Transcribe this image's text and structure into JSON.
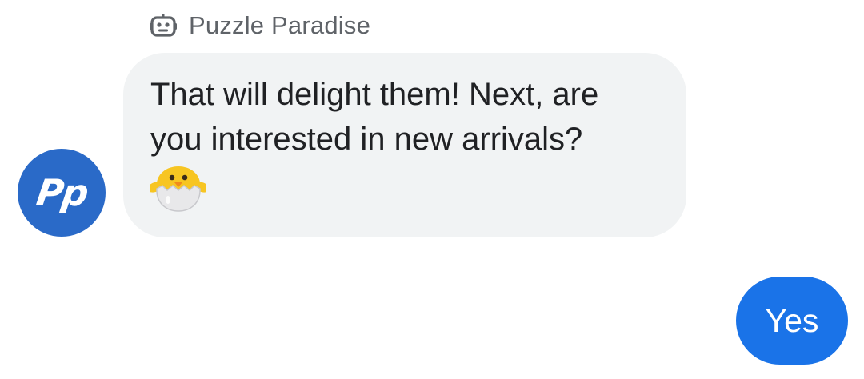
{
  "conversation": {
    "sender": {
      "name": "Puzzle Paradise",
      "icon": "bot-icon",
      "avatar_initials": "Pp",
      "avatar_color": "#2a6ac8"
    },
    "incoming_message": {
      "line1": "That will delight them! Next, are",
      "line2": "you interested in new arrivals?",
      "emoji": "hatching-chick-emoji",
      "bubble_color": "#f1f3f4"
    },
    "outgoing_message": {
      "text": "Yes",
      "bubble_color": "#1a73e8"
    }
  }
}
